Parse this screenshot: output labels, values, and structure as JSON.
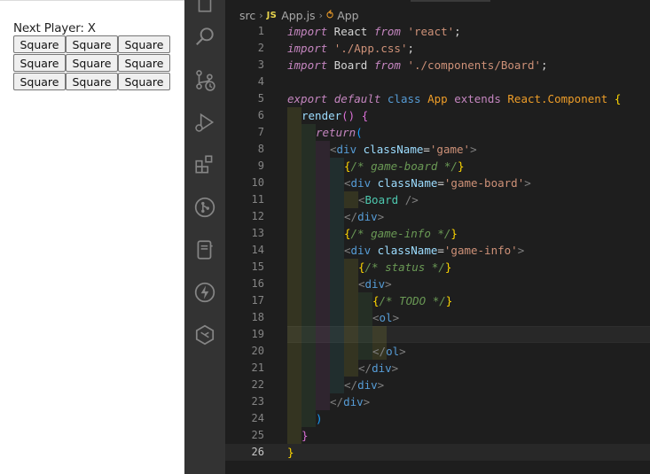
{
  "preview": {
    "status": "Next Player: X",
    "squares": [
      [
        "Square",
        "Square",
        "Square"
      ],
      [
        "Square",
        "Square",
        "Square"
      ],
      [
        "Square",
        "Square",
        "Square"
      ]
    ]
  },
  "editor": {
    "breadcrumb": {
      "folder": "src",
      "file_badge": "JS",
      "file": "App.js",
      "symbol": "App"
    },
    "current_line": 26,
    "lines": [
      {
        "n": "1"
      },
      {
        "n": "2"
      },
      {
        "n": "3"
      },
      {
        "n": "4"
      },
      {
        "n": "5"
      },
      {
        "n": "6"
      },
      {
        "n": "7"
      },
      {
        "n": "8"
      },
      {
        "n": "9"
      },
      {
        "n": "10"
      },
      {
        "n": "11"
      },
      {
        "n": "12"
      },
      {
        "n": "13"
      },
      {
        "n": "14"
      },
      {
        "n": "15"
      },
      {
        "n": "16"
      },
      {
        "n": "17"
      },
      {
        "n": "18"
      },
      {
        "n": "19"
      },
      {
        "n": "20"
      },
      {
        "n": "21"
      },
      {
        "n": "22"
      },
      {
        "n": "23"
      },
      {
        "n": "24"
      },
      {
        "n": "25"
      },
      {
        "n": "26"
      }
    ],
    "code": {
      "l1": [
        "import",
        " React ",
        "from",
        " ",
        "'react'",
        ";"
      ],
      "l2": [
        "import",
        " ",
        "'./App.css'",
        ";"
      ],
      "l3": [
        "import",
        " Board ",
        "from",
        " ",
        "'./components/Board'",
        ";"
      ],
      "l5": [
        "export",
        " ",
        "default",
        " ",
        "class",
        " ",
        "App",
        " ",
        "extends",
        " ",
        "React.Component",
        " ",
        "{"
      ],
      "l6": [
        "render",
        "()",
        " ",
        "{"
      ],
      "l7": [
        "return",
        "("
      ],
      "l8": [
        "<",
        "div",
        " ",
        "className",
        "=",
        "'game'",
        ">"
      ],
      "l9": [
        "{",
        "/* game-board */",
        "}"
      ],
      "l10": [
        "<",
        "div",
        " ",
        "className",
        "=",
        "'game-board'",
        ">"
      ],
      "l11": [
        "<",
        "Board",
        " />"
      ],
      "l12": [
        "</",
        "div",
        ">"
      ],
      "l13": [
        "{",
        "/* game-info */",
        "}"
      ],
      "l14": [
        "<",
        "div",
        " ",
        "className",
        "=",
        "'game-info'",
        ">"
      ],
      "l15": [
        "{",
        "/* status */",
        "}"
      ],
      "l16": [
        "<",
        "div",
        ">"
      ],
      "l17": [
        "{",
        "/* TODO */",
        "}"
      ],
      "l18": [
        "<",
        "ol",
        ">"
      ],
      "l20": [
        "</",
        "ol",
        ">"
      ],
      "l21": [
        "</",
        "div",
        ">"
      ],
      "l22": [
        "</",
        "div",
        ">"
      ],
      "l23": [
        "</",
        "div",
        ">"
      ],
      "l24": [
        ")"
      ],
      "l25": [
        "}"
      ],
      "l26": [
        "}"
      ]
    }
  },
  "icons": [
    "explorer-icon",
    "search-icon",
    "source-control-icon",
    "run-debug-icon",
    "extensions-icon",
    "git-graph-icon",
    "notebook-icon",
    "thunder-icon",
    "remote-icon"
  ],
  "colors": {
    "editor_bg": "#1e1e1e",
    "activity_bar": "#333333",
    "keyword": "#569cd6",
    "string": "#ce9178",
    "class": "#4ec9b0",
    "comment": "#6a9955"
  }
}
